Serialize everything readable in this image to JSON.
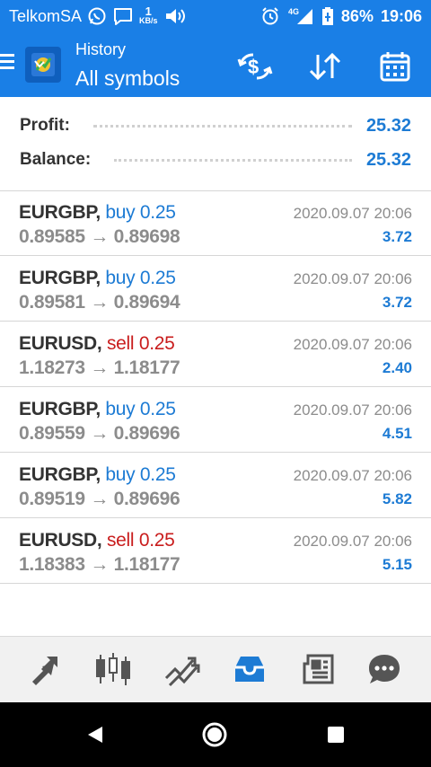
{
  "status_bar": {
    "carrier": "TelkomSA",
    "speed_value": "1",
    "speed_unit": "KB/s",
    "network": "4G",
    "battery": "86%",
    "time": "19:06",
    "icons": [
      "whatsapp-icon",
      "message-icon",
      "volume-icon",
      "alarm-icon",
      "signal-icon",
      "battery-icon"
    ]
  },
  "app_bar": {
    "subtitle": "History",
    "title": "All symbols",
    "actions": [
      "currency-exchange-icon",
      "sort-icon",
      "calendar-icon"
    ]
  },
  "summary": {
    "profit_label": "Profit:",
    "profit_value": "25.32",
    "balance_label": "Balance:",
    "balance_value": "25.32"
  },
  "trades": [
    {
      "symbol": "EURGBP,",
      "type": "buy 0.25",
      "side": "buy",
      "open": "0.89585",
      "arrow": "→",
      "close": "0.89698",
      "time": "2020.09.07 20:06",
      "profit": "3.72"
    },
    {
      "symbol": "EURGBP,",
      "type": "buy 0.25",
      "side": "buy",
      "open": "0.89581",
      "arrow": "→",
      "close": "0.89694",
      "time": "2020.09.07 20:06",
      "profit": "3.72"
    },
    {
      "symbol": "EURUSD,",
      "type": "sell 0.25",
      "side": "sell",
      "open": "1.18273",
      "arrow": "→",
      "close": "1.18177",
      "time": "2020.09.07 20:06",
      "profit": "2.40"
    },
    {
      "symbol": "EURGBP,",
      "type": "buy 0.25",
      "side": "buy",
      "open": "0.89559",
      "arrow": "→",
      "close": "0.89696",
      "time": "2020.09.07 20:06",
      "profit": "4.51"
    },
    {
      "symbol": "EURGBP,",
      "type": "buy 0.25",
      "side": "buy",
      "open": "0.89519",
      "arrow": "→",
      "close": "0.89696",
      "time": "2020.09.07 20:06",
      "profit": "5.82"
    },
    {
      "symbol": "EURUSD,",
      "type": "sell 0.25",
      "side": "sell",
      "open": "1.18383",
      "arrow": "→",
      "close": "1.18177",
      "time": "2020.09.07 20:06",
      "profit": "5.15"
    }
  ],
  "bottom_nav": {
    "items": [
      "quotes-icon",
      "chart-icon",
      "trade-icon",
      "history-icon",
      "news-icon",
      "chat-icon"
    ],
    "active": "history-icon"
  },
  "colors": {
    "primary": "#1a7fe6",
    "buy": "#1d7bd4",
    "sell": "#c91d1d",
    "muted": "#8c8c8c",
    "nav_active": "#1d7bd4",
    "nav_inactive": "#555555"
  }
}
